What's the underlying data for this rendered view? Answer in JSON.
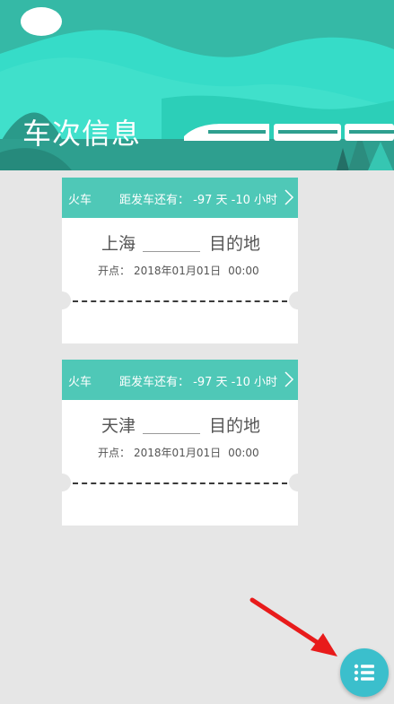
{
  "header": {
    "title": "车次信息"
  },
  "tickets": [
    {
      "type": "火车",
      "countdown": "距发车还有： -97 天 -10 小时",
      "from": "上海",
      "to": "目的地",
      "depart_label": "开点：",
      "depart_date": "2018年01月01日",
      "depart_time": "00:00"
    },
    {
      "type": "火车",
      "countdown": "距发车还有： -97 天 -10 小时",
      "from": "天津",
      "to": "目的地",
      "depart_label": "开点：",
      "depart_date": "2018年01月01日",
      "depart_time": "00:00"
    }
  ],
  "fab": {
    "icon": "list-icon"
  },
  "colors": {
    "teal_header": "#4fc8b7",
    "banner_bright": "#36dcc8",
    "banner_dark": "#2ea896",
    "fab": "#3bbfcc",
    "arrow": "#e81b1b",
    "background": "#e6e6e6"
  }
}
